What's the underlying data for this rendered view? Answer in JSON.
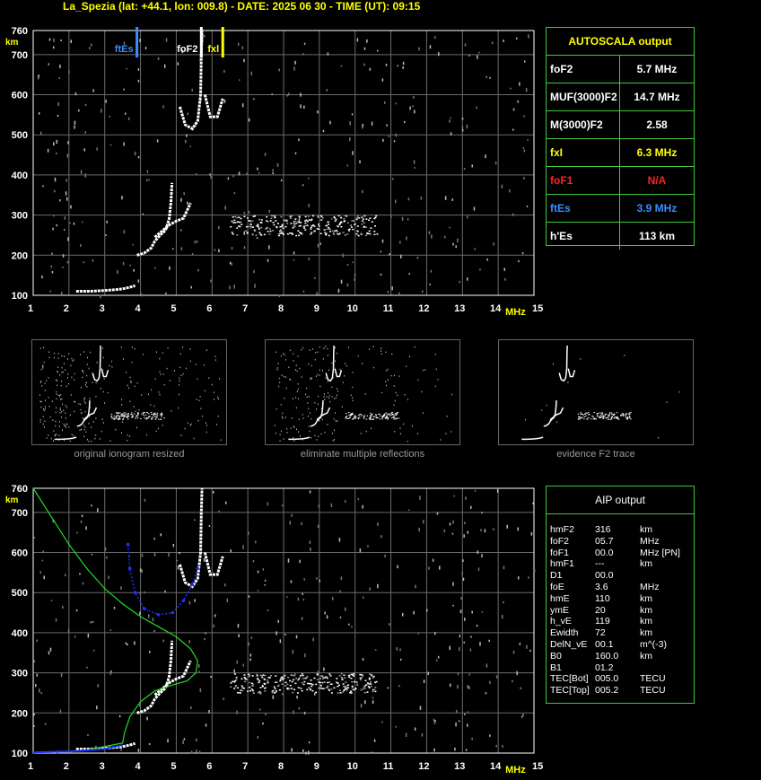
{
  "header": {
    "title": "La_Spezia (lat: +44.1, lon: 009.8) - DATE: 2025 06 30 - TIME (UT): 09:15"
  },
  "colors": {
    "grid": "#6b6b6b",
    "axis": "#ffffff",
    "yellow": "#ffff00",
    "green": "#3ec93e",
    "red": "#ff2020",
    "blue": "#3a8dff",
    "profile": "#22dd22",
    "profile_blue": "#2030ff"
  },
  "chart_data": [
    {
      "type": "scatter",
      "name_id": "ionogram-top",
      "xlabel": "MHz",
      "ylabel": "km",
      "xlim": [
        1,
        15
      ],
      "ylim": [
        100,
        760
      ],
      "xticks": [
        "1",
        "2",
        "3",
        "4",
        "5",
        "6",
        "7",
        "8",
        "9",
        "10",
        "11",
        "12",
        "13",
        "14",
        "15"
      ],
      "yticks": [
        "100",
        "200",
        "300",
        "400",
        "500",
        "600",
        "700",
        "760"
      ],
      "grid": true,
      "markers": [
        {
          "label": "ftEs",
          "x": 3.9,
          "color": "#3a8dff"
        },
        {
          "label": "foF2",
          "x": 5.7,
          "color": "#ffffff"
        },
        {
          "label": "fxl",
          "x": 6.3,
          "color": "#ffff00"
        }
      ],
      "traces": {
        "es_layer": [
          [
            2.2,
            110
          ],
          [
            2.6,
            110
          ],
          [
            3.0,
            112
          ],
          [
            3.3,
            114
          ],
          [
            3.5,
            116
          ],
          [
            3.7,
            120
          ],
          [
            3.85,
            124
          ]
        ],
        "f_ordinary_lower": [
          [
            3.9,
            200
          ],
          [
            4.1,
            205
          ],
          [
            4.3,
            218
          ],
          [
            4.4,
            235
          ],
          [
            4.55,
            250
          ],
          [
            4.7,
            262
          ],
          [
            4.8,
            290
          ],
          [
            4.85,
            330
          ],
          [
            4.88,
            380
          ]
        ],
        "f_extra_lower": [
          [
            4.4,
            245
          ],
          [
            4.6,
            260
          ],
          [
            4.8,
            275
          ],
          [
            5.0,
            285
          ],
          [
            5.2,
            292
          ],
          [
            5.4,
            330
          ]
        ],
        "f_ordinary_upper": [
          [
            5.1,
            570
          ],
          [
            5.25,
            525
          ],
          [
            5.45,
            515
          ],
          [
            5.6,
            535
          ],
          [
            5.68,
            600
          ],
          [
            5.7,
            700
          ],
          [
            5.72,
            760
          ]
        ],
        "f_extra_upper": [
          [
            5.8,
            600
          ],
          [
            5.95,
            545
          ],
          [
            6.15,
            545
          ],
          [
            6.3,
            590
          ]
        ]
      }
    },
    {
      "type": "scatter",
      "name_id": "ionogram-bottom",
      "xlabel": "MHz",
      "ylabel": "km",
      "xlim": [
        1,
        15
      ],
      "ylim": [
        100,
        760
      ],
      "xticks": [
        "1",
        "2",
        "3",
        "4",
        "5",
        "6",
        "7",
        "8",
        "9",
        "10",
        "11",
        "12",
        "13",
        "14",
        "15"
      ],
      "yticks": [
        "100",
        "200",
        "300",
        "400",
        "500",
        "600",
        "700",
        "760"
      ],
      "grid": true,
      "profile_green": [
        [
          1.0,
          760
        ],
        [
          1.5,
          690
        ],
        [
          2.0,
          620
        ],
        [
          2.5,
          560
        ],
        [
          3.0,
          510
        ],
        [
          3.5,
          472
        ],
        [
          4.0,
          440
        ],
        [
          4.5,
          415
        ],
        [
          5.0,
          390
        ],
        [
          5.4,
          360
        ],
        [
          5.6,
          330
        ],
        [
          5.55,
          300
        ],
        [
          5.3,
          280
        ],
        [
          4.9,
          270
        ],
        [
          4.4,
          255
        ],
        [
          4.0,
          228
        ],
        [
          3.7,
          190
        ],
        [
          3.55,
          150
        ],
        [
          3.5,
          125
        ],
        [
          2.5,
          108
        ],
        [
          1.5,
          102
        ],
        [
          1.0,
          102
        ]
      ],
      "profile_blue": [
        [
          3.65,
          620
        ],
        [
          3.7,
          560
        ],
        [
          3.85,
          500
        ],
        [
          4.1,
          460
        ],
        [
          4.5,
          445
        ],
        [
          4.9,
          450
        ],
        [
          5.2,
          480
        ],
        [
          5.45,
          520
        ],
        [
          5.6,
          560
        ],
        [
          1.0,
          102
        ],
        [
          2.0,
          104
        ],
        [
          3.0,
          110
        ],
        [
          3.5,
          120
        ]
      ]
    }
  ],
  "thumbnails": [
    {
      "caption": "original ionogram resized"
    },
    {
      "caption": "eliminate multiple reflections"
    },
    {
      "caption": "evidence F2 trace"
    }
  ],
  "autoscala": {
    "title": "AUTOSCALA output",
    "rows": [
      {
        "key": "foF2",
        "value": "5.7 MHz",
        "color": "#ffffff"
      },
      {
        "key": "MUF(3000)F2",
        "value": "14.7 MHz",
        "color": "#ffffff"
      },
      {
        "key": "M(3000)F2",
        "value": "2.58",
        "color": "#ffffff"
      },
      {
        "key": "fxI",
        "value": "6.3 MHz",
        "color": "#ffff00"
      },
      {
        "key": "foF1",
        "value": "N/A",
        "color": "#ff2020"
      },
      {
        "key": "ftEs",
        "value": "3.9 MHz",
        "color": "#3a8dff"
      },
      {
        "key": "h'Es",
        "value": "113     km",
        "color": "#ffffff"
      }
    ]
  },
  "aip": {
    "title": "AIP output",
    "rows": [
      [
        "hmF2",
        "316",
        "km"
      ],
      [
        "foF2",
        "05.7",
        "MHz"
      ],
      [
        "foF1",
        "00.0",
        "MHz  [PN]"
      ],
      [
        "hmF1",
        "---",
        "km"
      ],
      [
        "D1",
        "00.0",
        ""
      ],
      [
        "foE",
        "3.6",
        "MHz"
      ],
      [
        "hmE",
        "110",
        "km"
      ],
      [
        "ymE",
        "20",
        "km"
      ],
      [
        "h_vE",
        "119",
        "km"
      ],
      [
        "Ewidth",
        "72",
        "km"
      ],
      [
        "DelN_vE",
        "00.1",
        "m^(-3)"
      ],
      [
        "B0",
        "160.0",
        "km"
      ],
      [
        "B1",
        "01.2",
        ""
      ],
      [
        "TEC[Bot]",
        "005.0",
        "TECU"
      ],
      [
        "TEC[Top]",
        "005.2",
        "TECU"
      ]
    ]
  }
}
